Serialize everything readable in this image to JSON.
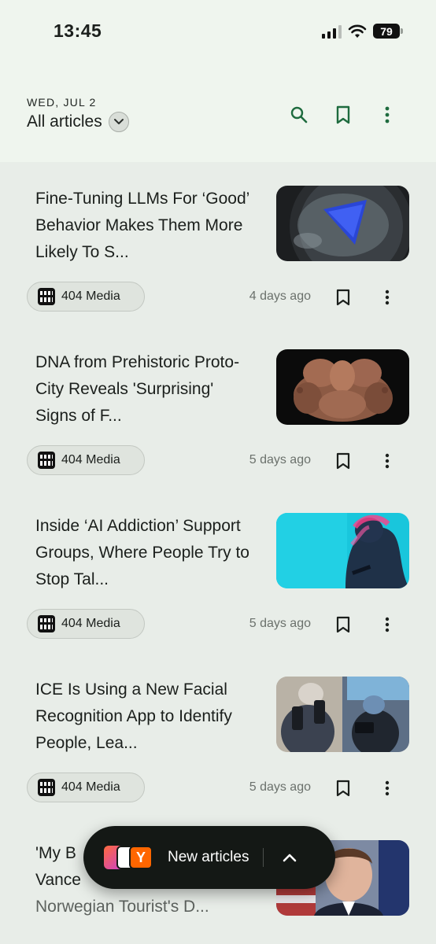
{
  "status_bar": {
    "time": "13:45",
    "battery": "79"
  },
  "header": {
    "date": "WED, JUL 2",
    "filter_label": "All articles",
    "icons": [
      "search-icon",
      "bookmark-icon",
      "more-vert-icon"
    ]
  },
  "articles": [
    {
      "title": "Fine-Tuning LLMs For ‘Good’ Behavior Makes Them More Likely To S...",
      "source": "404 Media",
      "age": "4 days ago"
    },
    {
      "title": "DNA from Prehistoric Proto-City Reveals 'Surprising' Signs of F...",
      "source": "404 Media",
      "age": "5 days ago"
    },
    {
      "title": "Inside ‘AI Addiction’ Support Groups, Where People Try to Stop Tal...",
      "source": "404 Media",
      "age": "5 days ago"
    },
    {
      "title": "ICE Is Using a New Facial Recognition App to Identify People, Lea...",
      "source": "404 Media",
      "age": "5 days ago"
    },
    {
      "title_line1": "'My B",
      "title_line2": "Vance",
      "title_line3": "Norwegian Tourist's D..."
    }
  ],
  "toast": {
    "label": "New articles",
    "badge_letter": "Y"
  },
  "colors": {
    "accent": "#1e6b3e",
    "background": "#e8ede8",
    "header_bg": "#eff5ee",
    "toast_bg": "#141815"
  }
}
